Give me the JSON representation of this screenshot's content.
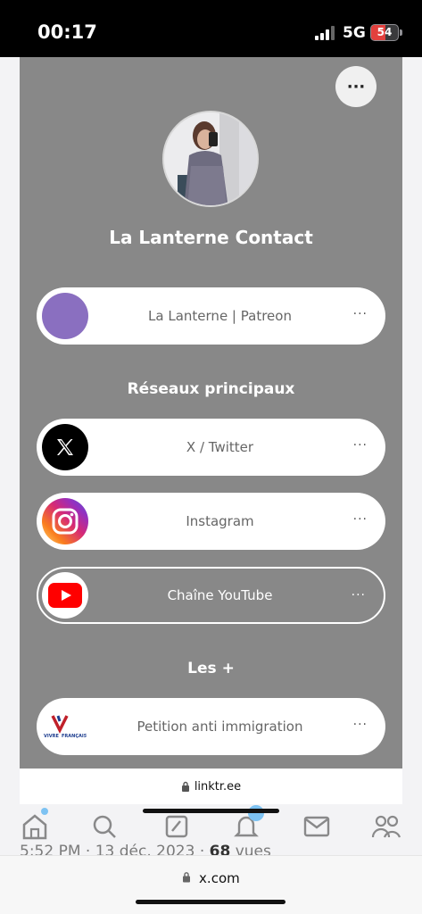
{
  "status_bar": {
    "time": "00:17",
    "network": "5G",
    "battery": "54"
  },
  "profile": {
    "more_label": "···",
    "name": "La Lanterne Contact"
  },
  "links": [
    {
      "label": "La Lanterne | Patreon",
      "more": "···"
    }
  ],
  "sections": [
    {
      "title": "Réseaux principaux",
      "links": [
        {
          "label": "X / Twitter",
          "more": "···"
        },
        {
          "label": "Instagram",
          "more": "···"
        },
        {
          "label": "Chaîne YouTube",
          "more": "···"
        }
      ]
    },
    {
      "title": "Les +",
      "links": [
        {
          "label": "Petition anti immigration",
          "more": "···",
          "logo_text_top": "VIVRE",
          "logo_text_bottom": "FRANÇAIS"
        }
      ]
    }
  ],
  "inner_url": "linktr.ee",
  "tweet_meta": {
    "time": "5:52 PM · 13 déc. 2023 · ",
    "views": "68",
    "views_suffix": " vues"
  },
  "browser_url": "x.com",
  "colors": {
    "linktree_bg": "#888888",
    "patreon_circle": "#8a6fc0",
    "x_bg": "#000000",
    "youtube_red": "#ff0000",
    "twitter_blue": "#1d9bf0"
  },
  "icons": [
    "home-icon",
    "search-icon",
    "compose-icon",
    "bell-icon",
    "mail-icon",
    "communities-icon",
    "lock-icon"
  ]
}
